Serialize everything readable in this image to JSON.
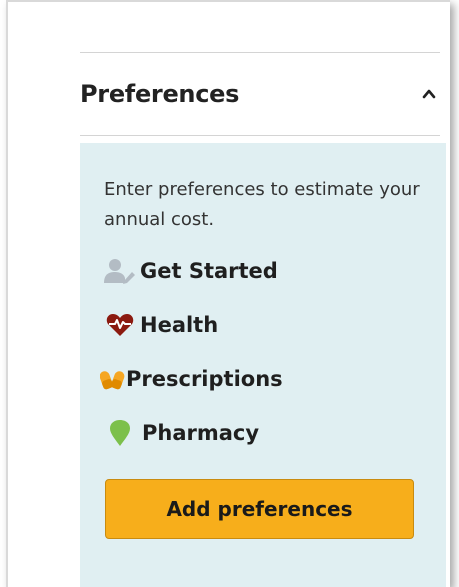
{
  "preferences": {
    "title": "Preferences",
    "description": "Enter preferences to estimate your annual cost.",
    "items": [
      {
        "label": "Get Started",
        "icon": "user-edit-icon",
        "color": "#b3bcc4"
      },
      {
        "label": "Health",
        "icon": "heartbeat-icon",
        "color": "#8b1a10"
      },
      {
        "label": "Prescriptions",
        "icon": "pills-icon",
        "color": "#f5a623"
      },
      {
        "label": "Pharmacy",
        "icon": "map-pin-icon",
        "color": "#7cc04b"
      }
    ],
    "button_label": "Add preferences",
    "colors": {
      "panel_background": "#e0eff2",
      "button": "#f7ae1b",
      "heading": "#222222"
    }
  }
}
